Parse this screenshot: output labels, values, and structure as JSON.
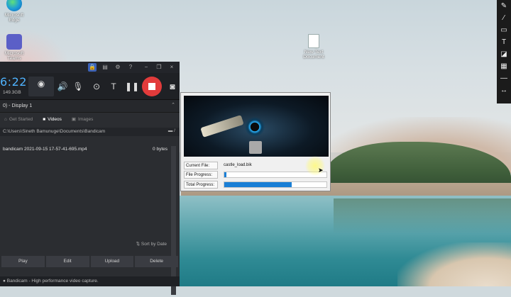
{
  "desktop": {
    "icons": [
      {
        "label": "Microsoft Edge",
        "icon": "edge-icon"
      },
      {
        "label": "Microsoft Teams",
        "icon": "teams-icon"
      },
      {
        "label": "New Text Document",
        "icon": "text-file-icon"
      }
    ]
  },
  "draw_toolbar": {
    "tools": [
      "pen-icon",
      "brush-icon",
      "rectangle-icon",
      "text-icon",
      "eraser-icon",
      "pattern-icon",
      "line-icon",
      "expand-icon"
    ]
  },
  "bandicam": {
    "timer": "6:22",
    "file_size": "149.3GB",
    "display_label": "0) - Display 1",
    "tabs": {
      "get_started": "Get Started",
      "videos": "Videos",
      "images": "Images"
    },
    "path": "C:\\Users\\Sineth Bamunuge\\Documents\\Bandicam",
    "files": [
      {
        "name": "bandicam 2021-09-15 17-57-41-695.mp4",
        "size": "0 bytes"
      }
    ],
    "sort_label": "Sort by Date",
    "actions": {
      "play": "Play",
      "edit": "Edit",
      "upload": "Upload",
      "delete": "Delete"
    },
    "status": "Bandicam - High performance video capture.",
    "accent": "#4fb3ff",
    "record_color": "#e23b3b"
  },
  "loader": {
    "current_file_label": "Current File:",
    "current_file": "castle_load.bik",
    "file_progress_label": "File Progress:",
    "file_progress": 0.02,
    "total_progress_label": "Total Progress:",
    "total_progress": 0.66,
    "bar_color": "#1a7fd6"
  }
}
